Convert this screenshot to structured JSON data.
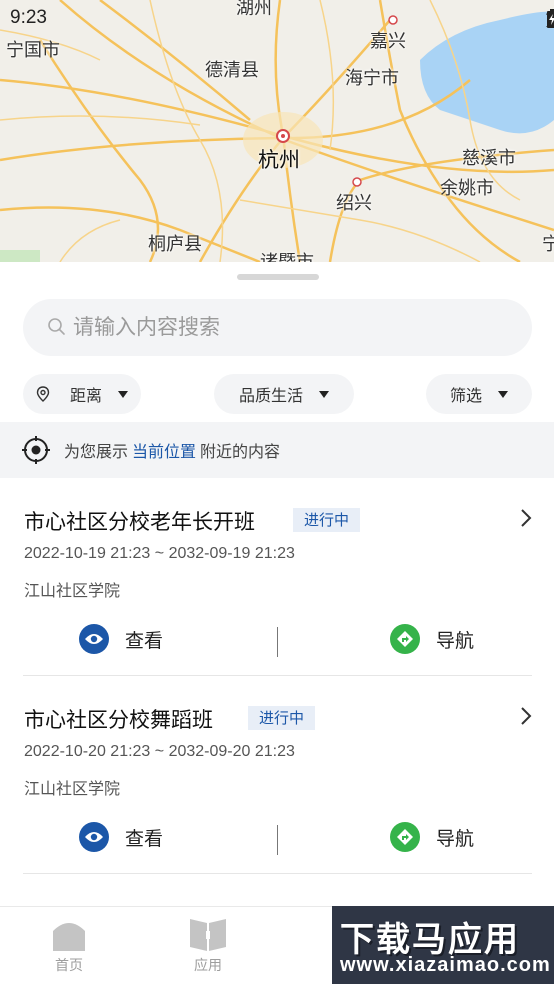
{
  "status_bar": {
    "time": "9:23"
  },
  "map": {
    "labels": {
      "huzhou": "湖州",
      "ningguo": "宁国市",
      "jiaxing": "嘉兴",
      "deqing": "德清县",
      "haining": "海宁市",
      "hangzhou": "杭州",
      "cixi": "慈溪市",
      "yuyao": "余姚市",
      "shaoxing": "绍兴",
      "tonglu": "桐庐县",
      "zhuji": "诸暨市",
      "ning_edge": "宁"
    }
  },
  "search": {
    "placeholder": "请输入内容搜索"
  },
  "filters": {
    "distance": "距离",
    "category": "品质生活",
    "screen": "筛选"
  },
  "location_notice": {
    "prefix": "为您展示",
    "link": "当前位置",
    "suffix": "附近的内容"
  },
  "cards": [
    {
      "title": "市心社区分校老年长开班",
      "status": "进行中",
      "date_range": "2022-10-19 21:23 ~ 2032-09-19 21:23",
      "org": "江山社区学院",
      "view_label": "查看",
      "nav_label": "导航"
    },
    {
      "title": "市心社区分校舞蹈班",
      "status": "进行中",
      "date_range": "2022-10-20 21:23 ~ 2032-09-20 21:23",
      "org": "江山社区学院",
      "view_label": "查看",
      "nav_label": "导航"
    }
  ],
  "bottom_nav": {
    "home": "首页",
    "apps": "应用"
  },
  "watermark": {
    "main": "下载马应用",
    "sub": "www.xiazaimao.com"
  },
  "colors": {
    "accent": "#1c57a8",
    "view_icon": "#1c57a8",
    "nav_icon": "#35b34a",
    "water": "#a9d3f5",
    "road": "#f5c25b"
  }
}
